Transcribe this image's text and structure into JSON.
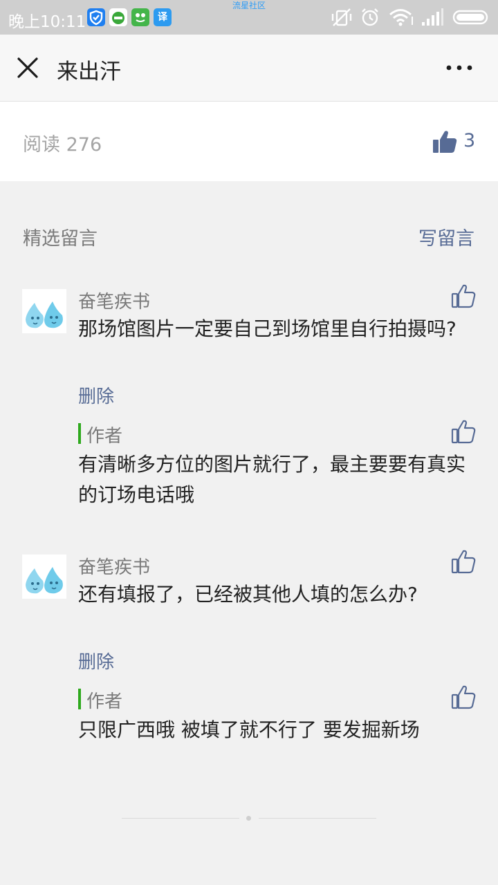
{
  "status_bar": {
    "time": "晚上10:11",
    "center_text": "流星社区",
    "app_icon_3_glyph": "译"
  },
  "nav": {
    "title": "来出汗"
  },
  "article_stats": {
    "read_text": "阅读 276",
    "like_count": "3"
  },
  "comments_section": {
    "title": "精选留言",
    "write_label": "写留言"
  },
  "comments": [
    {
      "nickname": "奋笔疾书",
      "content": "那场馆图片一定要自己到场馆里自行拍摄吗?",
      "delete_label": "删除",
      "reply": {
        "author_label": "作者",
        "content": "有清晰多方位的图片就行了，最主要要有真实的订场电话哦"
      }
    },
    {
      "nickname": "奋笔疾书",
      "content": "还有填报了，已经被其他人填的怎么办?",
      "delete_label": "删除",
      "reply": {
        "author_label": "作者",
        "content": "只限广西哦  被填了就不行了  要发掘新场"
      }
    }
  ],
  "colors": {
    "link": "#576b95",
    "author_bar": "#2ea91d",
    "status_bar_bg": "#cfcfcf"
  }
}
